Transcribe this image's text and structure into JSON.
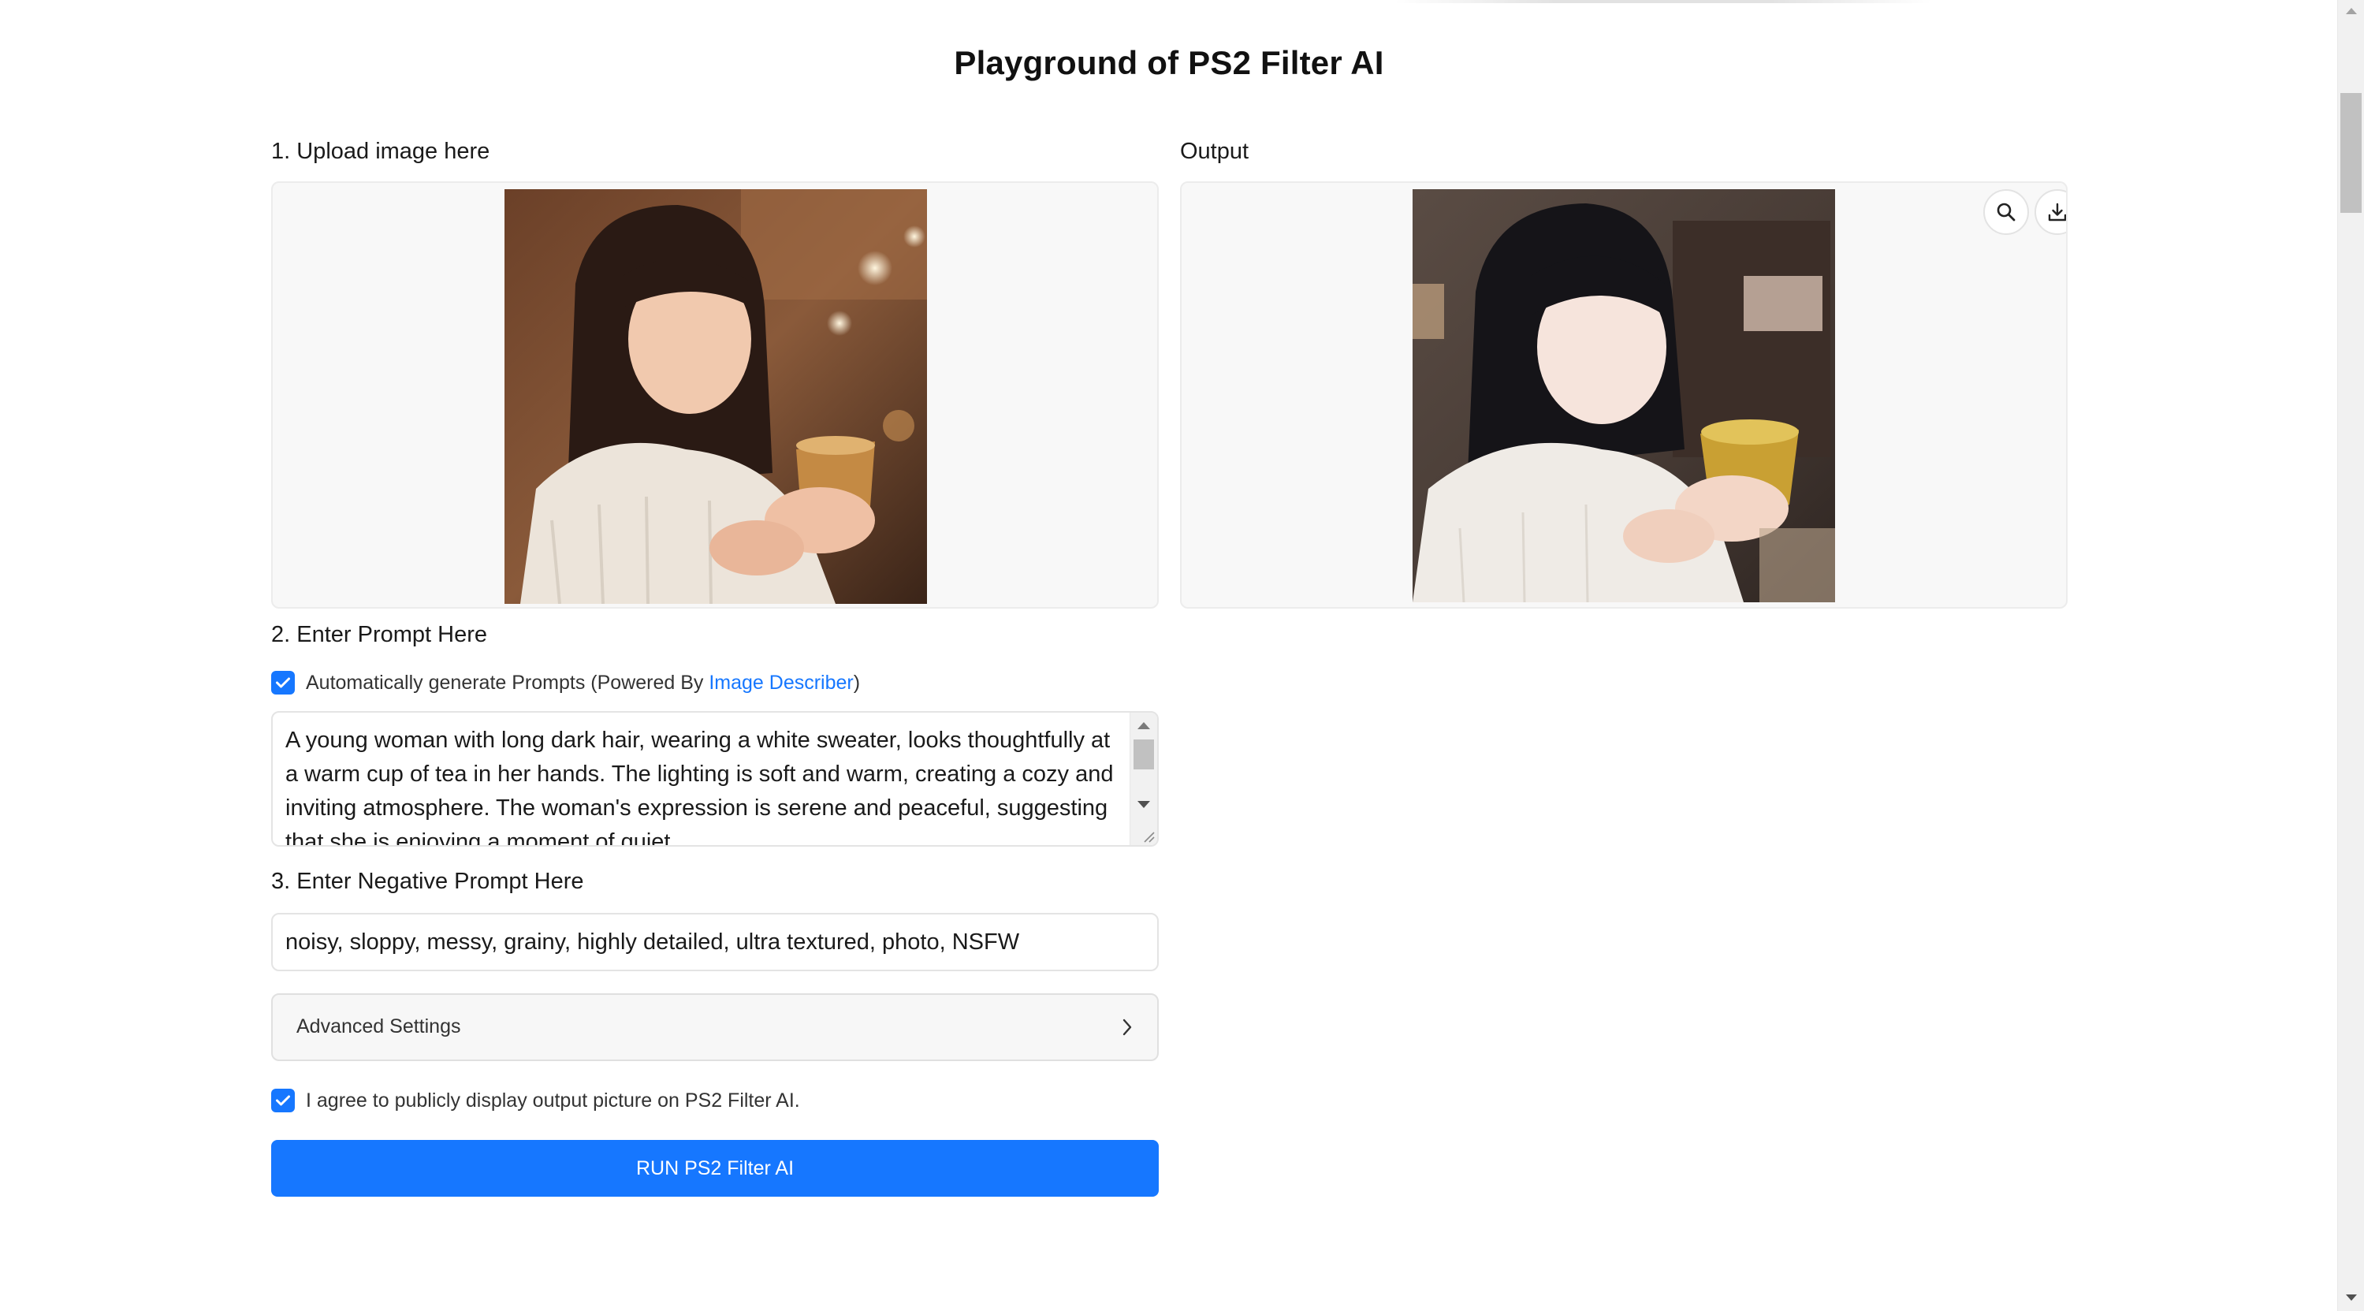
{
  "page": {
    "title": "Playground of PS2 Filter AI"
  },
  "upload": {
    "label": "1. Upload image here",
    "image_description": "photo-woman-holding-cup"
  },
  "output": {
    "label": "Output",
    "zoom_icon": "search-icon",
    "download_icon": "download-icon",
    "image_description": "ps2-filtered-woman-holding-cup"
  },
  "prompt": {
    "label": "2. Enter Prompt Here",
    "auto_checkbox_checked": true,
    "auto_label_prefix": "Automatically generate Prompts (Powered By ",
    "auto_label_link": "Image Describer",
    "auto_label_suffix": ")",
    "text": "A young woman with long dark hair, wearing a white sweater, looks thoughtfully at a warm cup of tea in her hands. The lighting is soft and warm, creating a cozy and inviting atmosphere. The woman's expression is serene and peaceful, suggesting that she is enjoying a moment of quiet"
  },
  "negative_prompt": {
    "label": "3. Enter Negative Prompt Here",
    "value": "noisy, sloppy, messy, grainy, highly detailed, ultra textured, photo, NSFW"
  },
  "advanced": {
    "label": "Advanced Settings",
    "expanded": false
  },
  "agree": {
    "checked": true,
    "label": "I agree to publicly display output picture on PS2 Filter AI."
  },
  "run_button": {
    "label": "RUN PS2 Filter AI"
  },
  "colors": {
    "accent": "#1677ff",
    "panel_bg": "#f8f8f8",
    "border": "#e4e4e4"
  }
}
